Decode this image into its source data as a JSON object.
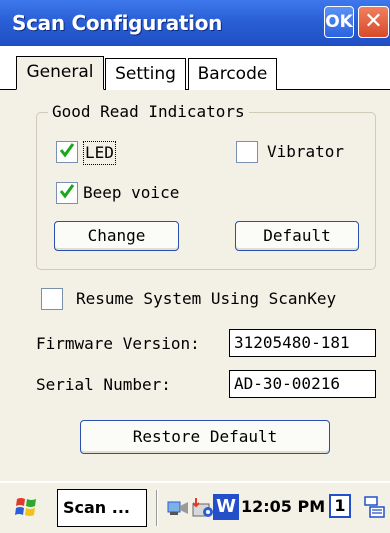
{
  "window": {
    "title": "Scan Configuration",
    "ok_label": "OK",
    "close_label": "✕"
  },
  "tabs": [
    {
      "label": "General",
      "selected": true
    },
    {
      "label": "Setting",
      "selected": false
    },
    {
      "label": "Barcode",
      "selected": false
    }
  ],
  "general": {
    "group_title": "Good Read Indicators",
    "led": {
      "label": "LED",
      "checked": true
    },
    "vibrator": {
      "label": "Vibrator",
      "checked": false
    },
    "beep": {
      "label": "Beep voice",
      "checked": true
    },
    "change_label": "Change",
    "default_label": "Default",
    "resume": {
      "label": "Resume System Using ScanKey",
      "checked": false
    },
    "firmware": {
      "label": "Firmware Version:",
      "value": "31205480-181"
    },
    "serial": {
      "label": "Serial Number:",
      "value": "AD-30-00216"
    },
    "restore_label": "Restore Default"
  },
  "taskbar": {
    "start_icon": "windows-flag-icon",
    "task_label": "Scan ...",
    "tray_icons": [
      "network-icon",
      "sync-icon",
      "word-icon"
    ],
    "tray_w_letter": "W",
    "clock": "12:05 PM",
    "indicator": "1",
    "keyboard_icon": "keyboard-icon"
  },
  "colors": {
    "titlebar": "#2a5fd6",
    "check_green": "#1aa81a",
    "panel_bg": "#f3f0e6"
  }
}
